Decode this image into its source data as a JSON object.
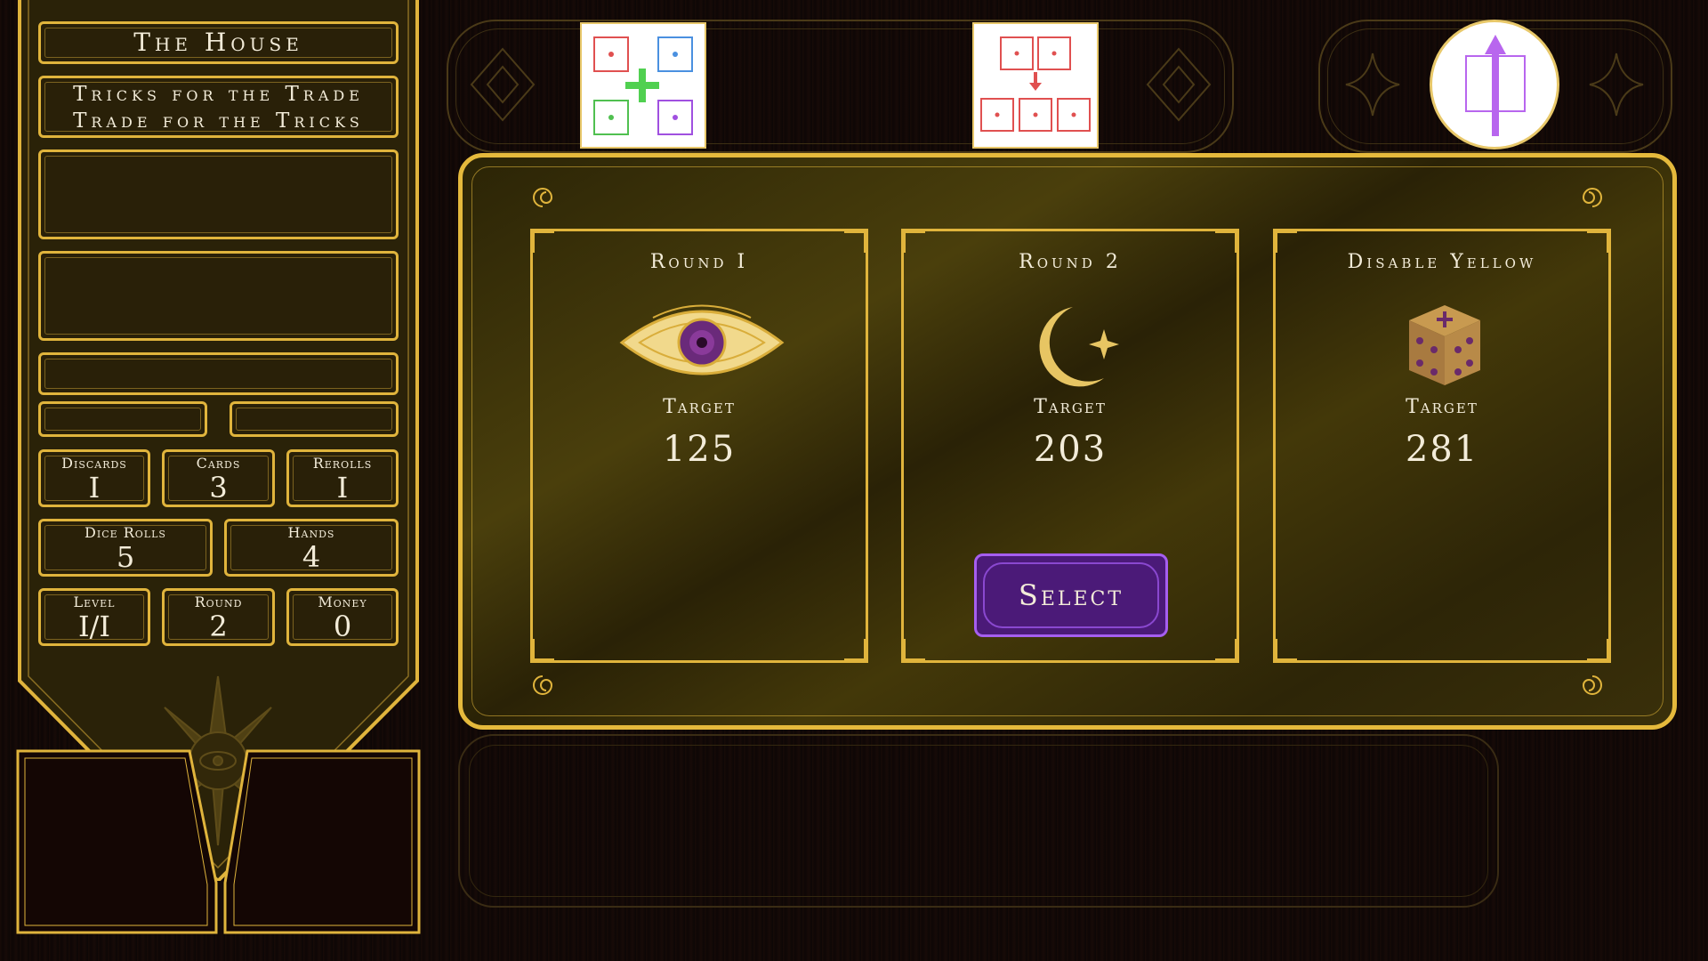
{
  "banner": {
    "title": "The House",
    "motto_line1": "Tricks for the Trade",
    "motto_line2": "Trade for the Tricks",
    "stats": {
      "discards": {
        "label": "Discards",
        "value": "I"
      },
      "cards": {
        "label": "Cards",
        "value": "3"
      },
      "rerolls": {
        "label": "Rerolls",
        "value": "I"
      },
      "dice_rolls": {
        "label": "Dice Rolls",
        "value": "5"
      },
      "hands": {
        "label": "Hands",
        "value": "4"
      },
      "level": {
        "label": "Level",
        "value": "I/I"
      },
      "round": {
        "label": "Round",
        "value": "2"
      },
      "money": {
        "label": "Money",
        "value": "0"
      }
    }
  },
  "top_items": [
    {
      "icon": "four-dice-plus-icon"
    },
    {
      "icon": "dice-merge-icon"
    },
    {
      "icon": "purple-arrow-token-icon"
    }
  ],
  "rounds": [
    {
      "title": "Round I",
      "icon": "eye-icon",
      "target_label": "Target",
      "target": "125"
    },
    {
      "title": "Round 2",
      "icon": "moon-star-icon",
      "target_label": "Target",
      "target": "203",
      "button": "Select"
    },
    {
      "title": "Disable Yellow",
      "icon": "dice-icon",
      "target_label": "Target",
      "target": "281"
    }
  ],
  "colors": {
    "gold": "#e0b43c",
    "purple": "#4b1a78",
    "accent_purple": "#b866ee"
  }
}
